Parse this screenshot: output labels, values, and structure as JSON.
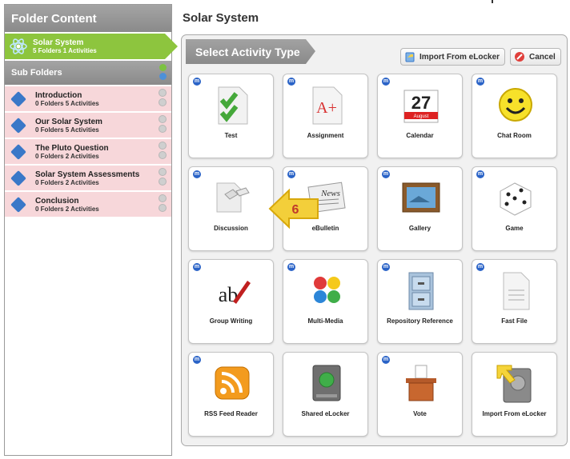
{
  "left": {
    "title": "Folder Content",
    "selected_folder": {
      "name": "Solar System",
      "counts": "5 Folders 1 Activities"
    },
    "subfolders_label": "Sub Folders",
    "subfolders": [
      {
        "name": "Introduction",
        "counts": "0 Folders 5 Activities"
      },
      {
        "name": "Our Solar System",
        "counts": "0 Folders 5 Activities"
      },
      {
        "name": "The Pluto Question",
        "counts": "0 Folders 2 Activities"
      },
      {
        "name": "Solar System Assessments",
        "counts": "0 Folders 2 Activities"
      },
      {
        "name": "Conclusion",
        "counts": "0 Folders 2 Activities"
      }
    ]
  },
  "main": {
    "title": "Solar System",
    "panel_title": "Select Activity Type",
    "import_label": "Import From eLocker",
    "cancel_label": "Cancel",
    "badge": "m",
    "activities": [
      {
        "label": "Test",
        "icon": "test-icon"
      },
      {
        "label": "Assignment",
        "icon": "assignment-icon"
      },
      {
        "label": "Calendar",
        "icon": "calendar-icon"
      },
      {
        "label": "Chat Room",
        "icon": "chat-room-icon"
      },
      {
        "label": "Discussion",
        "icon": "discussion-icon"
      },
      {
        "label": "eBulletin",
        "icon": "ebulletin-icon"
      },
      {
        "label": "Gallery",
        "icon": "gallery-icon"
      },
      {
        "label": "Game",
        "icon": "game-icon"
      },
      {
        "label": "Group Writing",
        "icon": "group-writing-icon"
      },
      {
        "label": "Multi-Media",
        "icon": "multi-media-icon"
      },
      {
        "label": "Repository Reference",
        "icon": "repository-reference-icon"
      },
      {
        "label": "Fast File",
        "icon": "fast-file-icon"
      },
      {
        "label": "RSS Feed Reader",
        "icon": "rss-icon"
      },
      {
        "label": "Shared eLocker",
        "icon": "shared-elocker-icon"
      },
      {
        "label": "Vote",
        "icon": "vote-icon"
      },
      {
        "label": "Import From eLocker",
        "icon": "import-elocker-icon"
      }
    ],
    "calendar_icon_text": {
      "day": "27",
      "month": "August"
    },
    "ebulletin_icon_text": "News",
    "assignment_icon_text": "A+",
    "group_writing_icon_text": "ab"
  },
  "callout": {
    "number": "6"
  },
  "colors": {
    "folder_green": "#8dc53e",
    "subfolder_pink": "#f7d7da",
    "accent_blue": "#2a63c7",
    "callout_yellow": "#f3cf3a"
  }
}
